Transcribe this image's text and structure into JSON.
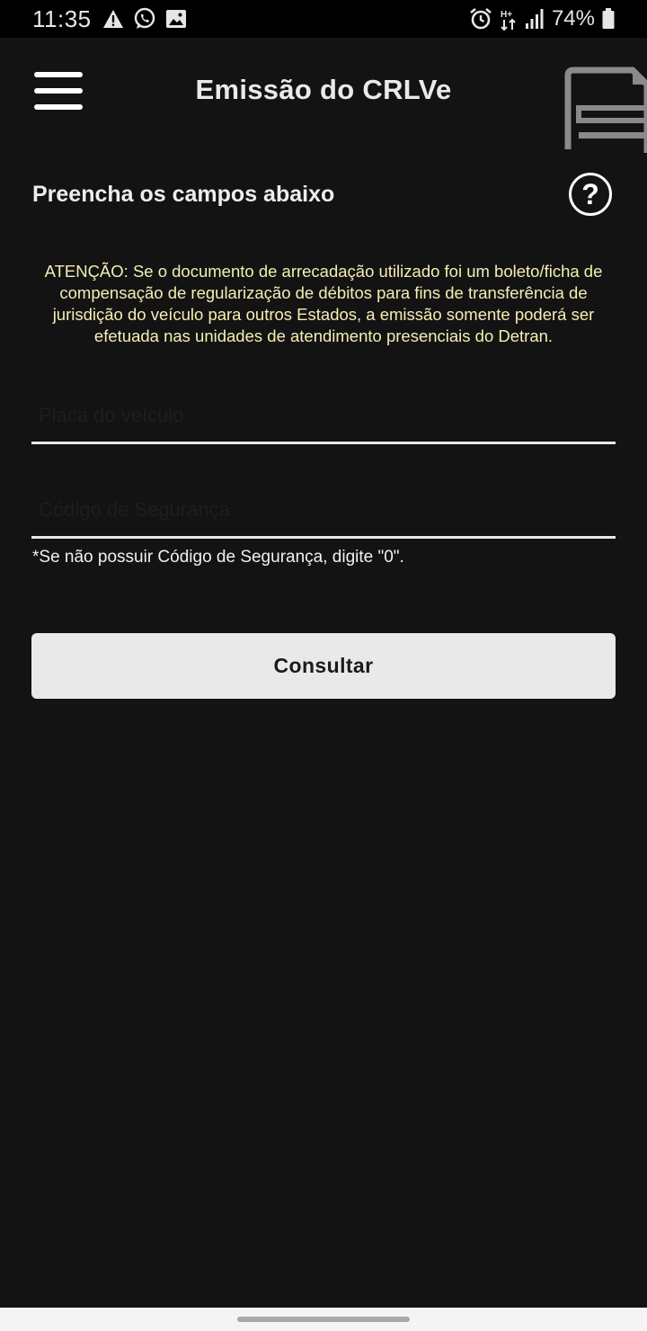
{
  "status_bar": {
    "time": "11:35",
    "battery": "74%",
    "left_icons": [
      "warning-icon",
      "whatsapp-icon",
      "image-icon"
    ],
    "right_icons": [
      "alarm-icon",
      "data-transfer-icon",
      "signal-icon",
      "battery-icon"
    ]
  },
  "header": {
    "title": "Emissão do CRLVe"
  },
  "form": {
    "section_title": "Preencha os campos abaixo",
    "warning": "ATENÇÃO: Se o documento de arrecadação utilizado foi um boleto/ficha de compensação de regularização de débitos para fins de transferência de jurisdição do veículo para outros Estados, a emissão somente poderá ser efetuada nas unidades de atendimento presenciais do Detran.",
    "placa": {
      "placeholder": "Placa do veículo",
      "value": ""
    },
    "codigo": {
      "placeholder": "Código de Segurança",
      "value": ""
    },
    "hint": "*Se não possuir Código de Segurança, digite \"0\".",
    "submit_label": "Consultar"
  },
  "colors": {
    "background": "#131313",
    "warning_text": "#f4eeb4",
    "button_bg": "#e9e9e9"
  }
}
